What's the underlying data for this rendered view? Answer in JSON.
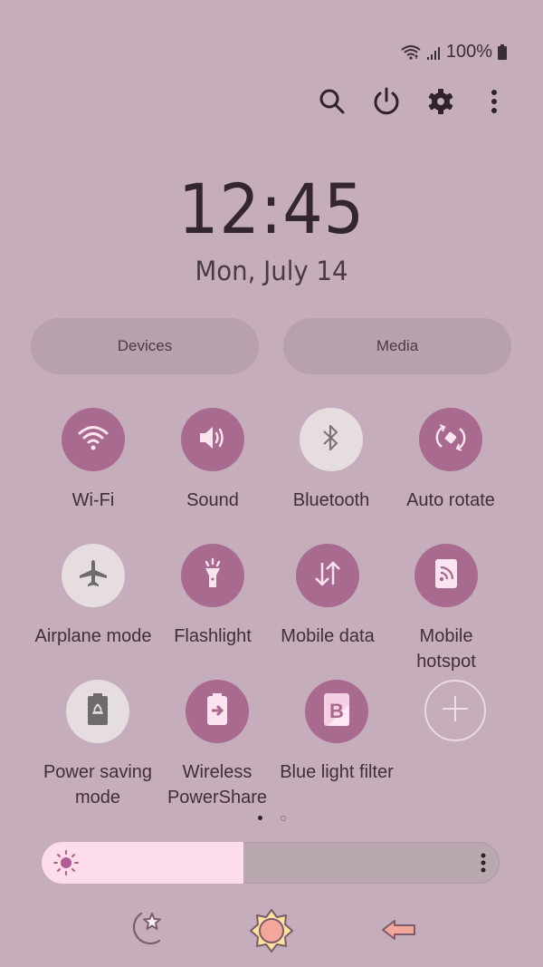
{
  "status_bar": {
    "wifi_icon": "wifi-icon",
    "signal_icon": "signal-icon",
    "battery_text": "100%",
    "battery_icon": "battery-icon"
  },
  "top_actions": [
    {
      "name": "search",
      "icon": "search-icon"
    },
    {
      "name": "power",
      "icon": "power-icon"
    },
    {
      "name": "settings",
      "icon": "gear-icon"
    },
    {
      "name": "more",
      "icon": "more-vertical-icon"
    }
  ],
  "clock": {
    "time": "12:45",
    "date": "Mon, July 14"
  },
  "pills": {
    "devices": "Devices",
    "media": "Media"
  },
  "tiles": [
    {
      "label": "Wi-Fi",
      "icon": "wifi-icon",
      "state": "on"
    },
    {
      "label": "Sound",
      "icon": "speaker-icon",
      "state": "on"
    },
    {
      "label": "Bluetooth",
      "icon": "bluetooth-icon",
      "state": "off"
    },
    {
      "label": "Auto rotate",
      "icon": "auto-rotate-icon",
      "state": "on"
    },
    {
      "label": "Airplane mode",
      "icon": "airplane-icon",
      "state": "off"
    },
    {
      "label": "Flashlight",
      "icon": "flashlight-icon",
      "state": "on"
    },
    {
      "label": "Mobile data",
      "icon": "mobile-data-icon",
      "state": "on"
    },
    {
      "label": "Mobile hotspot",
      "icon": "hotspot-icon",
      "state": "on"
    },
    {
      "label": "Power saving mode",
      "icon": "power-saving-icon",
      "state": "off"
    },
    {
      "label": "Wireless PowerShare",
      "icon": "wireless-powershare-icon",
      "state": "on"
    },
    {
      "label": "Blue light filter",
      "icon": "blue-light-filter-icon",
      "state": "on"
    },
    {
      "label": "",
      "icon": "add-icon",
      "state": "add"
    }
  ],
  "page_indicator": {
    "current": 1,
    "total": 2
  },
  "brightness": {
    "level_percent": 44,
    "icon": "sun-icon",
    "more_icon": "more-vertical-icon"
  },
  "bottom_icons": [
    {
      "name": "night-mode",
      "icon": "moon-star-icon"
    },
    {
      "name": "day-mode",
      "icon": "sun-badge-icon"
    },
    {
      "name": "back",
      "icon": "left-arrow-icon"
    }
  ],
  "colors": {
    "background": "#c6adbb",
    "tile_on": "#a86a8e",
    "tile_off": "#e5dde0",
    "brightness_fill": "#fddcec"
  }
}
